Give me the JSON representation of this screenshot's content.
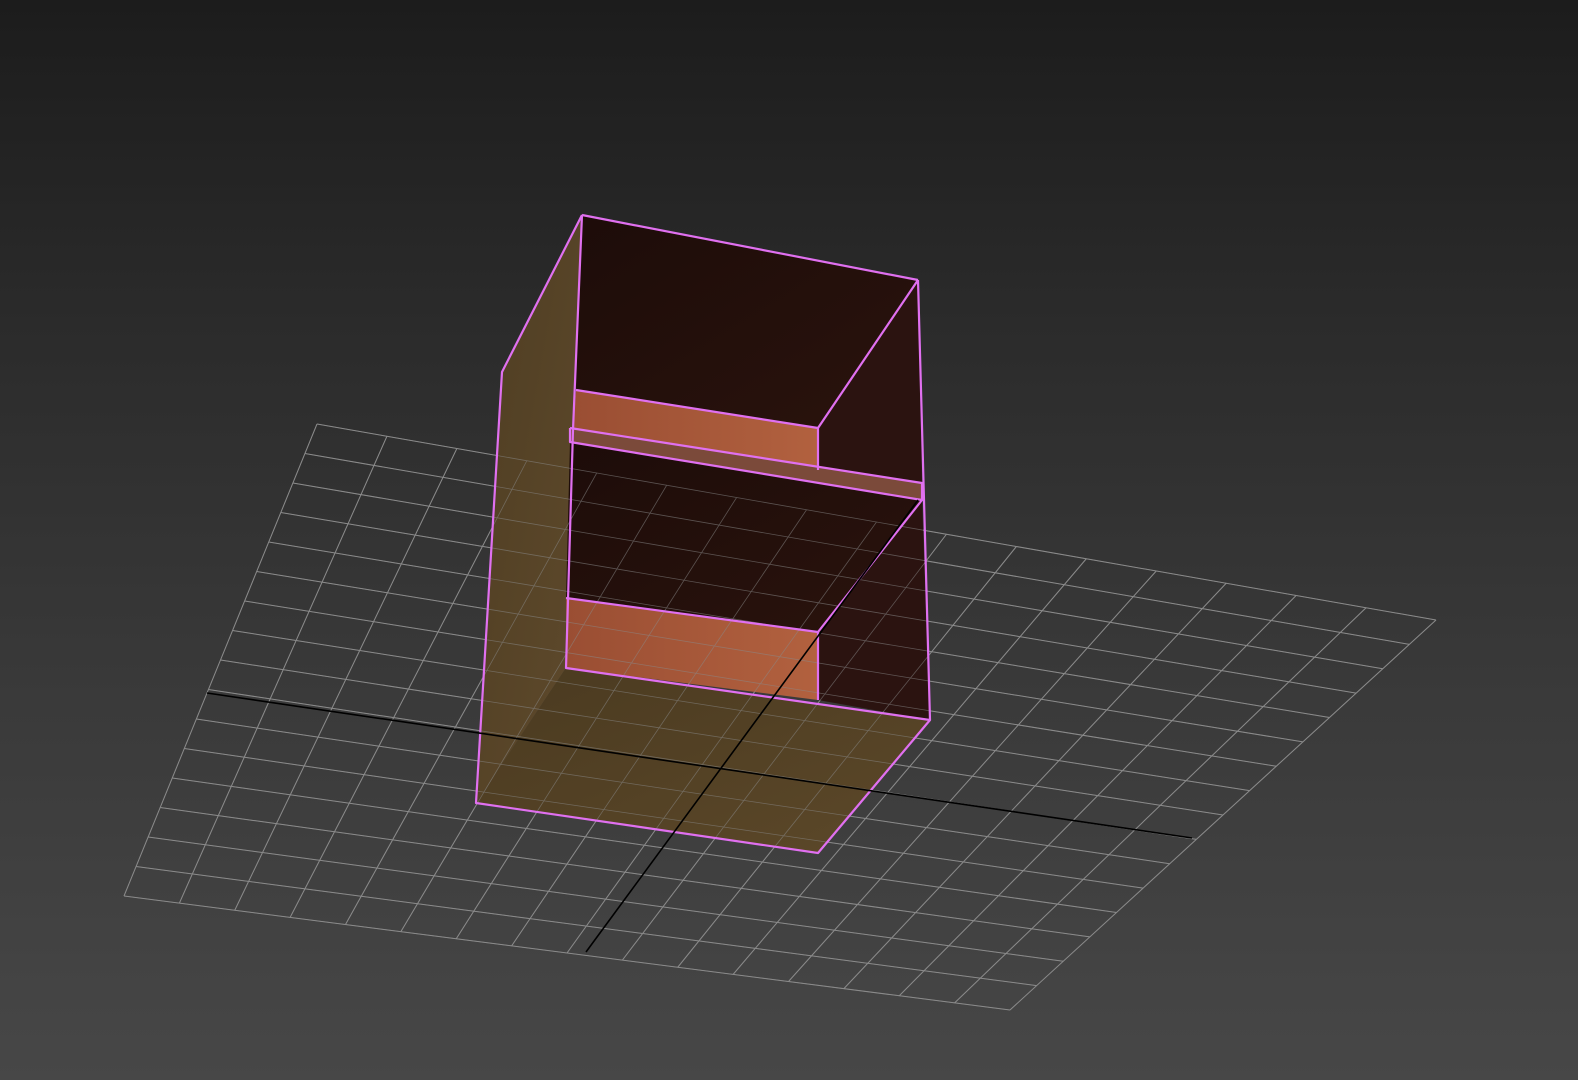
{
  "viewport": {
    "name": "perspective-viewport",
    "background_top": "#1c1c1c",
    "background_bottom": "#474747"
  },
  "scene": {
    "grid": {
      "visible": true,
      "line_color": "#8a8a8a",
      "axis_color": "#000000"
    },
    "object": {
      "type": "shelf-box",
      "selected": true,
      "selection_color": "#e070f0",
      "material": "wood",
      "shelf_color": "#a5583a",
      "interior_color": "#230f0c",
      "outer_color": "#5a4528"
    }
  }
}
